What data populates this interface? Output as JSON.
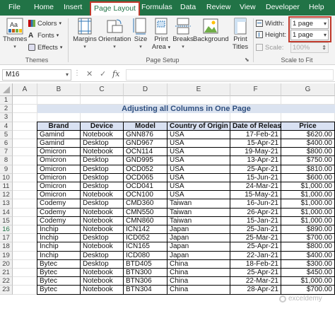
{
  "tabs": [
    {
      "label": "File"
    },
    {
      "label": "Home"
    },
    {
      "label": "Insert"
    },
    {
      "label": "Page Layout"
    },
    {
      "label": "Formulas"
    },
    {
      "label": "Data"
    },
    {
      "label": "Review"
    },
    {
      "label": "View"
    },
    {
      "label": "Developer"
    },
    {
      "label": "Help"
    }
  ],
  "ribbon": {
    "themes": {
      "themes_label": "Themes",
      "colors_label": "Colors",
      "fonts_label": "Fonts",
      "effects_label": "Effects",
      "group_label": "Themes"
    },
    "page_setup": {
      "margins": "Margins",
      "orientation": "Orientation",
      "size": "Size",
      "print_area": [
        "Print",
        "Area"
      ],
      "breaks": "Breaks",
      "background": "Background",
      "print_titles": [
        "Print",
        "Titles"
      ],
      "group_label": "Page Setup"
    },
    "scale": {
      "width_label": "Width:",
      "width_value": "1 page",
      "height_label": "Height:",
      "height_value": "1 page",
      "scale_label": "Scale:",
      "scale_value": "100%",
      "group_label": "Scale to Fit"
    }
  },
  "formula_bar": {
    "name_box": "M16",
    "fx_label": "fx",
    "formula": ""
  },
  "sheet": {
    "columns": [
      "A",
      "B",
      "C",
      "D",
      "E",
      "F",
      "G"
    ],
    "rows": [
      "1",
      "2",
      "3",
      "4",
      "5",
      "6",
      "7",
      "8",
      "9",
      "10",
      "11",
      "12",
      "13",
      "14",
      "15",
      "16",
      "17",
      "18",
      "19",
      "20",
      "21",
      "22",
      "23"
    ],
    "selected_row": "16",
    "title": "Adjusting all Columns in One Page",
    "table_headers": [
      "Brand",
      "Device",
      "Model",
      "Country of Origin",
      "Date of Release",
      "Price"
    ],
    "table_rows": [
      [
        "Gamind",
        "Notebook",
        "GNN876",
        "USA",
        "17-Feb-21",
        "$620.00"
      ],
      [
        "Gamind",
        "Desktop",
        "GND967",
        "USA",
        "15-Apr-21",
        "$400.00"
      ],
      [
        "Omicron",
        "Notebook",
        "OCN114",
        "USA",
        "19-May-21",
        "$800.00"
      ],
      [
        "Omicron",
        "Desktop",
        "GND995",
        "USA",
        "13-Apr-21",
        "$750.00"
      ],
      [
        "Omicron",
        "Desktop",
        "OCD052",
        "USA",
        "25-Apr-21",
        "$810.00"
      ],
      [
        "Omicron",
        "Desktop",
        "OCD065",
        "USA",
        "15-Jun-21",
        "$600.00"
      ],
      [
        "Omicron",
        "Desktop",
        "OCD041",
        "USA",
        "24-Mar-21",
        "$1,000.00"
      ],
      [
        "Omicron",
        "Notebook",
        "OCN100",
        "USA",
        "15-May-21",
        "$1,000.00"
      ],
      [
        "Codemy",
        "Desktop",
        "CMD360",
        "Taiwan",
        "16-Jun-21",
        "$1,000.00"
      ],
      [
        "Codemy",
        "Notebook",
        "CMN550",
        "Taiwan",
        "26-Apr-21",
        "$1,000.00"
      ],
      [
        "Codemy",
        "Notebook",
        "CMN860",
        "Taiwan",
        "15-Jan-21",
        "$1,000.00"
      ],
      [
        "Inchip",
        "Notebook",
        "ICN142",
        "Japan",
        "25-Jan-21",
        "$890.00"
      ],
      [
        "Inchip",
        "Desktop",
        "ICD052",
        "Japan",
        "25-Mar-21",
        "$700.00"
      ],
      [
        "Inchip",
        "Notebook",
        "ICN165",
        "Japan",
        "25-Apr-21",
        "$800.00"
      ],
      [
        "Inchip",
        "Desktop",
        "ICD080",
        "Japan",
        "22-Jan-21",
        "$400.00"
      ],
      [
        "Bytec",
        "Desktop",
        "BTD405",
        "China",
        "18-Feb-21",
        "$300.00"
      ],
      [
        "Bytec",
        "Notebook",
        "BTN300",
        "China",
        "25-Apr-21",
        "$450.00"
      ],
      [
        "Bytec",
        "Notebook",
        "BTN306",
        "China",
        "22-Mar-21",
        "$1,000.00"
      ],
      [
        "Bytec",
        "Notebook",
        "BTN304",
        "China",
        "28-Apr-21",
        "$700.00"
      ]
    ]
  },
  "watermark": "exceldemy",
  "colors": {
    "excel_green": "#217346",
    "highlight_red": "#c0392b",
    "title_fill": "#dbe3f0",
    "header_fill": "#d9e1f2"
  }
}
